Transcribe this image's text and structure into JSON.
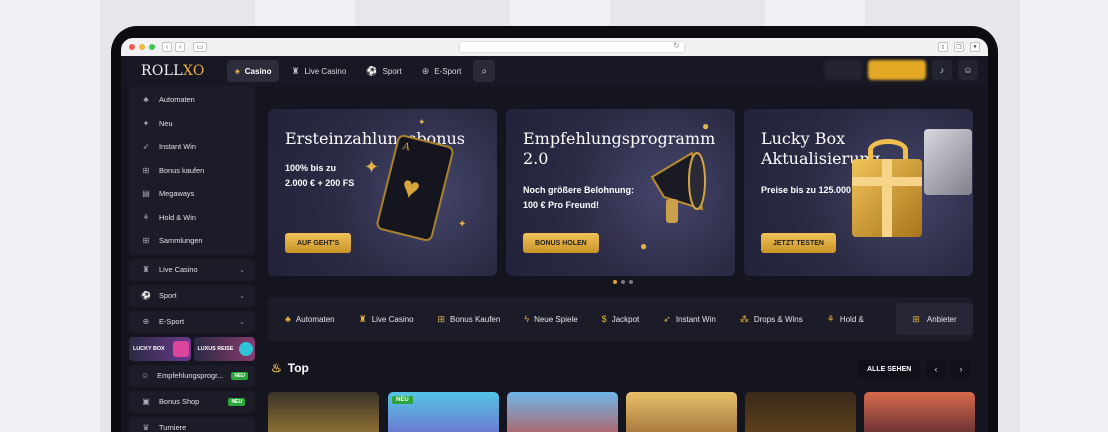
{
  "header": {
    "logo_main": "ROLL",
    "logo_accent": "XO",
    "nav": [
      {
        "label": "Casino",
        "icon": "spade-icon",
        "active": true
      },
      {
        "label": "Live Casino",
        "icon": "dealer-icon",
        "active": false
      },
      {
        "label": "Sport",
        "icon": "soccer-ball-icon",
        "active": false
      },
      {
        "label": "E-Sport",
        "icon": "gamepad-icon",
        "active": false
      }
    ]
  },
  "sidebar": {
    "items": [
      {
        "label": "Automaten",
        "icon": "cherries-icon"
      },
      {
        "label": "Neu",
        "icon": "sparkle-icon"
      },
      {
        "label": "Instant Win",
        "icon": "rocket-icon"
      },
      {
        "label": "Bonus kaufen",
        "icon": "gift-icon"
      },
      {
        "label": "Megaways",
        "icon": "megaways-icon"
      },
      {
        "label": "Hold & Win",
        "icon": "hold-win-icon"
      },
      {
        "label": "Sammlungen",
        "icon": "collections-icon"
      }
    ],
    "groups": [
      {
        "label": "Live Casino",
        "icon": "dealer-icon"
      },
      {
        "label": "Sport",
        "icon": "soccer-ball-icon"
      },
      {
        "label": "E-Sport",
        "icon": "gamepad-icon"
      }
    ],
    "promos": [
      "LUCKY BOX",
      "LUXUS REISE"
    ],
    "extras": [
      {
        "label": "Empfehlungsprogr...",
        "badge": "NEU",
        "icon": "referral-icon"
      },
      {
        "label": "Bonus Shop",
        "badge": "NEU",
        "icon": "shop-icon"
      },
      {
        "label": "Turniere",
        "icon": "trophy-icon"
      }
    ]
  },
  "banners": [
    {
      "title": "Ersteinzahlungsbonus",
      "text_1": "100% bis zu",
      "text_2": "2.000 € + 200 FS",
      "button": "AUF GEHT'S"
    },
    {
      "title_1": "Empfehlungsprogramm",
      "title_2": "2.0",
      "text_1": "Noch größere Belohnung:",
      "text_2": "100 € Pro Freund!",
      "button": "BONUS HOLEN"
    },
    {
      "title_1": "Lucky Box",
      "title_2": "Aktualisierung",
      "text_1": "Preise bis zu 125.000 €!",
      "button": "JETZT TESTEN"
    }
  ],
  "carousel": {
    "count": 3,
    "active": 0
  },
  "categories": [
    {
      "label": "Automaten",
      "icon": "cherries-icon"
    },
    {
      "label": "Live Casino",
      "icon": "dealer-icon"
    },
    {
      "label": "Bonus Kaufen",
      "icon": "gift-icon"
    },
    {
      "label": "Neue Spiele",
      "icon": "lightning-icon"
    },
    {
      "label": "Jackpot",
      "icon": "money-bag-icon"
    },
    {
      "label": "Instant Win",
      "icon": "rocket-icon"
    },
    {
      "label": "Drops & Wins",
      "icon": "drops-icon"
    },
    {
      "label": "Hold &",
      "icon": "hold-win-icon"
    }
  ],
  "providers_label": "Anbieter",
  "top_section": {
    "title": "Top",
    "see_all": "ALLE SEHEN",
    "new_badge": "NEU"
  },
  "colors": {
    "accent": "#e3b243",
    "button": "#e2a826",
    "background": "#15151f",
    "panel": "#1c1c29"
  }
}
